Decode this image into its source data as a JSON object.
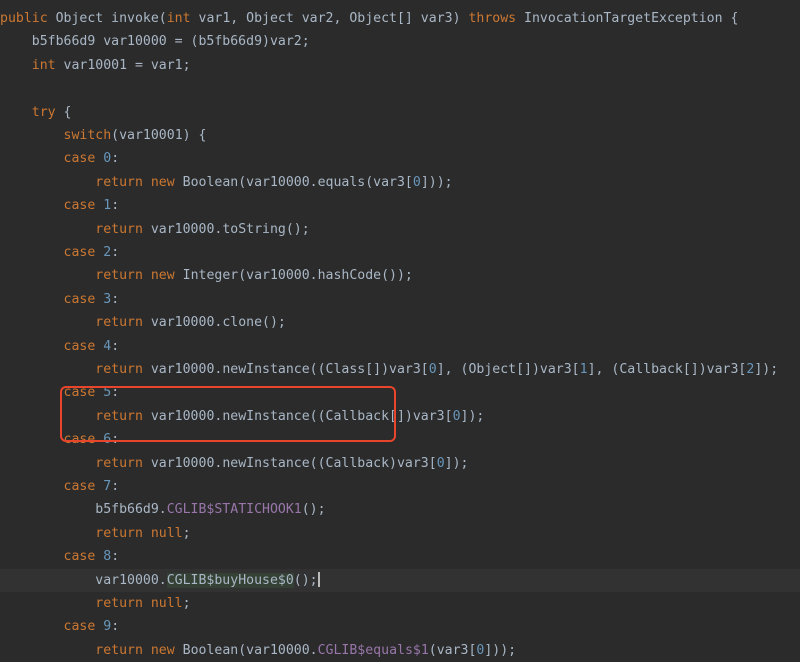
{
  "colors": {
    "background": "#2b2b2b",
    "text": "#a9b7c6",
    "keyword": "#cc7832",
    "number": "#6897bb",
    "field": "#9876aa",
    "match_highlight": "#344134",
    "annotation_box": "#e8452c"
  },
  "code": {
    "lines": [
      [
        {
          "t": "public",
          "c": "kw"
        },
        {
          "t": " Object invoke("
        },
        {
          "t": "int",
          "c": "kw"
        },
        {
          "t": " var1, Object var2, Object[] var3) "
        },
        {
          "t": "throws",
          "c": "kw"
        },
        {
          "t": " InvocationTargetException {"
        }
      ],
      [
        {
          "t": "    b5fb66d9 var10000 = (b5fb66d9)var2;"
        }
      ],
      [
        {
          "t": "    "
        },
        {
          "t": "int",
          "c": "kw"
        },
        {
          "t": " var10001 = var1;"
        }
      ],
      [
        {
          "t": ""
        }
      ],
      [
        {
          "t": "    "
        },
        {
          "t": "try",
          "c": "kw"
        },
        {
          "t": " {"
        }
      ],
      [
        {
          "t": "        "
        },
        {
          "t": "switch",
          "c": "kw"
        },
        {
          "t": "(var10001) {"
        }
      ],
      [
        {
          "t": "        "
        },
        {
          "t": "case",
          "c": "kw"
        },
        {
          "t": " "
        },
        {
          "t": "0",
          "c": "num"
        },
        {
          "t": ":"
        }
      ],
      [
        {
          "t": "            "
        },
        {
          "t": "return new",
          "c": "kw"
        },
        {
          "t": " Boolean(var10000.equals(var3["
        },
        {
          "t": "0",
          "c": "num"
        },
        {
          "t": "]));"
        }
      ],
      [
        {
          "t": "        "
        },
        {
          "t": "case",
          "c": "kw"
        },
        {
          "t": " "
        },
        {
          "t": "1",
          "c": "num"
        },
        {
          "t": ":"
        }
      ],
      [
        {
          "t": "            "
        },
        {
          "t": "return",
          "c": "kw"
        },
        {
          "t": " var10000.toString();"
        }
      ],
      [
        {
          "t": "        "
        },
        {
          "t": "case",
          "c": "kw"
        },
        {
          "t": " "
        },
        {
          "t": "2",
          "c": "num"
        },
        {
          "t": ":"
        }
      ],
      [
        {
          "t": "            "
        },
        {
          "t": "return new",
          "c": "kw"
        },
        {
          "t": " Integer(var10000.hashCode());"
        }
      ],
      [
        {
          "t": "        "
        },
        {
          "t": "case",
          "c": "kw"
        },
        {
          "t": " "
        },
        {
          "t": "3",
          "c": "num"
        },
        {
          "t": ":"
        }
      ],
      [
        {
          "t": "            "
        },
        {
          "t": "return",
          "c": "kw"
        },
        {
          "t": " var10000.clone();"
        }
      ],
      [
        {
          "t": "        "
        },
        {
          "t": "case",
          "c": "kw"
        },
        {
          "t": " "
        },
        {
          "t": "4",
          "c": "num"
        },
        {
          "t": ":"
        }
      ],
      [
        {
          "t": "            "
        },
        {
          "t": "return",
          "c": "kw"
        },
        {
          "t": " var10000.newInstance((Class[])var3["
        },
        {
          "t": "0",
          "c": "num"
        },
        {
          "t": "], (Object[])var3["
        },
        {
          "t": "1",
          "c": "num"
        },
        {
          "t": "], (Callback[])var3["
        },
        {
          "t": "2",
          "c": "num"
        },
        {
          "t": "]);"
        }
      ],
      [
        {
          "t": "        "
        },
        {
          "t": "case",
          "c": "kw"
        },
        {
          "t": " "
        },
        {
          "t": "5",
          "c": "num"
        },
        {
          "t": ":"
        }
      ],
      [
        {
          "t": "            "
        },
        {
          "t": "return",
          "c": "kw"
        },
        {
          "t": " var10000.newInstance((Callback[])var3["
        },
        {
          "t": "0",
          "c": "num"
        },
        {
          "t": "]);"
        }
      ],
      [
        {
          "t": "        "
        },
        {
          "t": "case",
          "c": "kw"
        },
        {
          "t": " "
        },
        {
          "t": "6",
          "c": "num"
        },
        {
          "t": ":"
        }
      ],
      [
        {
          "t": "            "
        },
        {
          "t": "return",
          "c": "kw"
        },
        {
          "t": " var10000.newInstance((Callback)var3["
        },
        {
          "t": "0",
          "c": "num"
        },
        {
          "t": "]);"
        }
      ],
      [
        {
          "t": "        "
        },
        {
          "t": "case",
          "c": "kw"
        },
        {
          "t": " "
        },
        {
          "t": "7",
          "c": "num"
        },
        {
          "t": ":"
        }
      ],
      [
        {
          "t": "            b5fb66d9."
        },
        {
          "t": "CGLIB$STATICHOOK1",
          "c": "fld"
        },
        {
          "t": "();"
        }
      ],
      [
        {
          "t": "            "
        },
        {
          "t": "return null",
          "c": "kw"
        },
        {
          "t": ";"
        }
      ],
      [
        {
          "t": "        "
        },
        {
          "t": "case",
          "c": "kw"
        },
        {
          "t": " "
        },
        {
          "t": "8",
          "c": "num"
        },
        {
          "t": ":"
        }
      ],
      [
        {
          "t": "            var10000."
        },
        {
          "t": "CGLIB$buyHouse$0",
          "c": "hl"
        },
        {
          "t": "();"
        },
        {
          "t": "",
          "c": "caret"
        }
      ],
      [
        {
          "t": "            "
        },
        {
          "t": "return null",
          "c": "kw"
        },
        {
          "t": ";"
        }
      ],
      [
        {
          "t": "        "
        },
        {
          "t": "case",
          "c": "kw"
        },
        {
          "t": " "
        },
        {
          "t": "9",
          "c": "num"
        },
        {
          "t": ":"
        }
      ],
      [
        {
          "t": "            "
        },
        {
          "t": "return new",
          "c": "kw"
        },
        {
          "t": " Boolean(var10000."
        },
        {
          "t": "CGLIB$equals$1",
          "c": "fld"
        },
        {
          "t": "(var3["
        },
        {
          "t": "0",
          "c": "num"
        },
        {
          "t": "]));"
        }
      ]
    ]
  }
}
